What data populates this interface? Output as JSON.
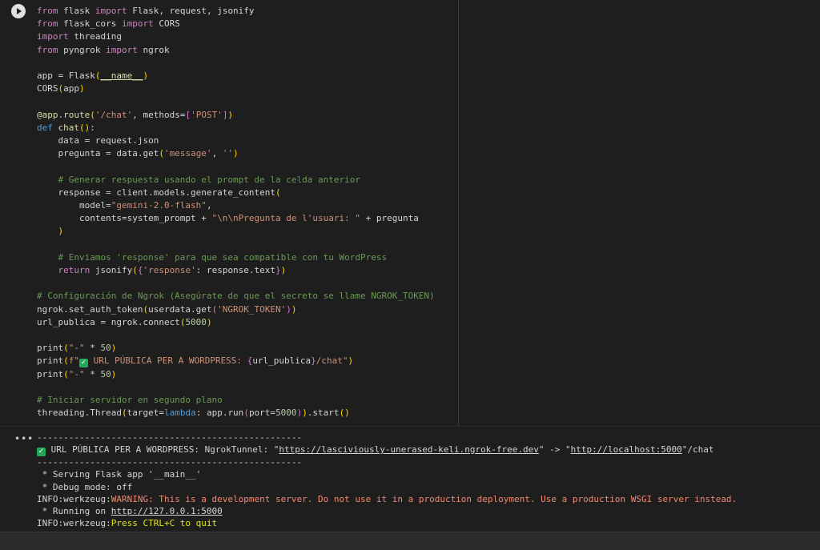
{
  "run_button": {
    "icon": "play-icon"
  },
  "output_menu": {
    "icon": "ellipsis-icon",
    "label": "•••"
  },
  "code": {
    "lines": [
      [
        [
          "kw",
          "from"
        ],
        [
          "t",
          " flask "
        ],
        [
          "kw",
          "import"
        ],
        [
          "t",
          " Flask, request, jsonify"
        ]
      ],
      [
        [
          "kw",
          "from"
        ],
        [
          "t",
          " flask_cors "
        ],
        [
          "kw",
          "import"
        ],
        [
          "t",
          " CORS"
        ]
      ],
      [
        [
          "kw",
          "import"
        ],
        [
          "t",
          " threading"
        ]
      ],
      [
        [
          "kw",
          "from"
        ],
        [
          "t",
          " pyngrok "
        ],
        [
          "kw",
          "import"
        ],
        [
          "t",
          " ngrok"
        ]
      ],
      [],
      [
        [
          "t",
          "app = Flask"
        ],
        [
          "br",
          "("
        ],
        [
          "dn",
          "__name__"
        ],
        [
          "br",
          ")"
        ]
      ],
      [
        [
          "t",
          "CORS"
        ],
        [
          "br",
          "("
        ],
        [
          "t",
          "app"
        ],
        [
          "br",
          ")"
        ]
      ],
      [],
      [
        [
          "dec",
          "@app.route"
        ],
        [
          "br",
          "("
        ],
        [
          "str",
          "'/chat'"
        ],
        [
          "t",
          ", methods="
        ],
        [
          "br2",
          "["
        ],
        [
          "str",
          "'POST'"
        ],
        [
          "br2",
          "]"
        ],
        [
          "br",
          ")"
        ]
      ],
      [
        [
          "kwb",
          "def"
        ],
        [
          "t",
          " "
        ],
        [
          "fn",
          "chat"
        ],
        [
          "br",
          "()"
        ],
        [
          "t",
          ":"
        ]
      ],
      [
        [
          "t",
          "    data = request.json"
        ]
      ],
      [
        [
          "t",
          "    pregunta = data.get"
        ],
        [
          "br",
          "("
        ],
        [
          "str",
          "'message'"
        ],
        [
          "t",
          ", "
        ],
        [
          "str",
          "''"
        ],
        [
          "br",
          ")"
        ]
      ],
      [],
      [
        [
          "cm",
          "    # Generar respuesta usando el prompt de la celda anterior"
        ]
      ],
      [
        [
          "t",
          "    response = client.models.generate_content"
        ],
        [
          "br",
          "("
        ]
      ],
      [
        [
          "t",
          "        model="
        ],
        [
          "str",
          "\"gemini-2.0-flash\""
        ],
        [
          "t",
          ","
        ]
      ],
      [
        [
          "t",
          "        contents=system_prompt + "
        ],
        [
          "str",
          "\"\\n\\nPregunta de l'usuari: \""
        ],
        [
          "t",
          " + pregunta"
        ]
      ],
      [
        [
          "br",
          "    )"
        ]
      ],
      [],
      [
        [
          "cm",
          "    # Enviamos 'response' para que sea compatible con tu WordPress"
        ]
      ],
      [
        [
          "kw",
          "    return"
        ],
        [
          "t",
          " jsonify"
        ],
        [
          "br",
          "("
        ],
        [
          "br2",
          "{"
        ],
        [
          "str",
          "'response'"
        ],
        [
          "t",
          ": response.text"
        ],
        [
          "br2",
          "}"
        ],
        [
          "br",
          ")"
        ]
      ],
      [],
      [
        [
          "cm",
          "# Configuración de Ngrok (Asegúrate de que el secreto se llame NGROK_TOKEN)"
        ]
      ],
      [
        [
          "t",
          "ngrok.set_auth_token"
        ],
        [
          "br",
          "("
        ],
        [
          "t",
          "userdata.get"
        ],
        [
          "br2",
          "("
        ],
        [
          "str",
          "'NGROK_TOKEN'"
        ],
        [
          "br2",
          ")"
        ],
        [
          "br",
          ")"
        ]
      ],
      [
        [
          "t",
          "url_publica = ngrok.connect"
        ],
        [
          "br",
          "("
        ],
        [
          "num",
          "5000"
        ],
        [
          "br",
          ")"
        ]
      ],
      [],
      [
        [
          "t",
          "print"
        ],
        [
          "br",
          "("
        ],
        [
          "str",
          "\"-\""
        ],
        [
          "t",
          " * "
        ],
        [
          "num",
          "50"
        ],
        [
          "br",
          ")"
        ]
      ],
      [
        [
          "t",
          "print"
        ],
        [
          "br",
          "("
        ],
        [
          "str",
          "f\""
        ],
        [
          "check",
          "✓"
        ],
        [
          "str",
          " URL PÚBLICA PER A WORDPRESS: "
        ],
        [
          "br2",
          "{"
        ],
        [
          "t",
          "url_publica"
        ],
        [
          "br2",
          "}"
        ],
        [
          "str",
          "/chat\""
        ],
        [
          "br",
          ")"
        ]
      ],
      [
        [
          "t",
          "print"
        ],
        [
          "br",
          "("
        ],
        [
          "str",
          "\"-\""
        ],
        [
          "t",
          " * "
        ],
        [
          "num",
          "50"
        ],
        [
          "br",
          ")"
        ]
      ],
      [],
      [
        [
          "cm",
          "# Iniciar servidor en segundo plano"
        ]
      ],
      [
        [
          "t",
          "threading.Thread"
        ],
        [
          "br",
          "("
        ],
        [
          "t",
          "target="
        ],
        [
          "kwb",
          "lambda"
        ],
        [
          "t",
          ": app.run"
        ],
        [
          "br2",
          "("
        ],
        [
          "t",
          "port="
        ],
        [
          "num",
          "5000"
        ],
        [
          "br2",
          ")"
        ],
        [
          "br",
          ")"
        ],
        [
          "t",
          ".start"
        ],
        [
          "br",
          "()"
        ]
      ]
    ]
  },
  "output": {
    "lines": [
      [
        [
          "t",
          "--------------------------------------------------"
        ]
      ],
      [
        [
          "check",
          "✓"
        ],
        [
          "t",
          " URL PÚBLICA PER A WORDPRESS: NgrokTunnel: \""
        ],
        [
          "link",
          "https://lasciviously-unerased-keli.ngrok-free.dev"
        ],
        [
          "t",
          "\" -> \""
        ],
        [
          "link",
          "http://localhost:5000"
        ],
        [
          "t",
          "\"/chat"
        ]
      ],
      [
        [
          "t",
          "--------------------------------------------------"
        ]
      ],
      [
        [
          "t",
          " * Serving Flask app '__main__'"
        ]
      ],
      [
        [
          "t",
          " * Debug mode: off"
        ]
      ],
      [
        [
          "t",
          "INFO:werkzeug:"
        ],
        [
          "warn",
          "WARNING: This is a development server. Do not use it in a production deployment. Use a production WSGI server instead."
        ]
      ],
      [
        [
          "t",
          " * Running on "
        ],
        [
          "link",
          "http://127.0.0.1:5000"
        ]
      ],
      [
        [
          "t",
          "INFO:werkzeug:"
        ],
        [
          "yel",
          "Press CTRL+C to quit"
        ]
      ]
    ]
  }
}
